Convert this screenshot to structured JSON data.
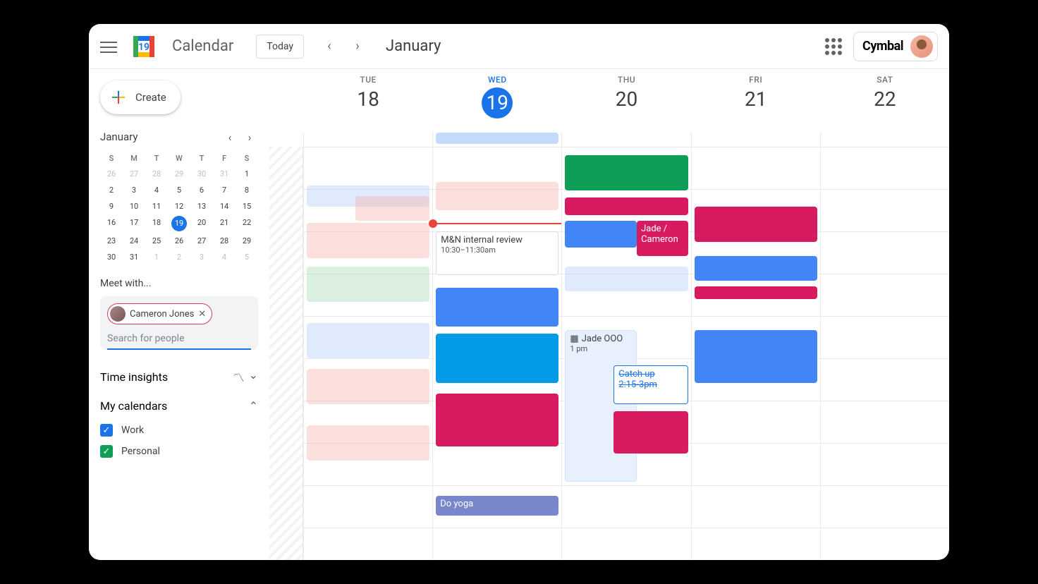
{
  "header": {
    "app_title": "Calendar",
    "today_label": "Today",
    "month_title": "January",
    "org_name": "Cymbal"
  },
  "sidebar": {
    "create_label": "Create",
    "mini_month": "January",
    "dow": [
      "S",
      "M",
      "T",
      "W",
      "T",
      "F",
      "S"
    ],
    "weeks": [
      [
        "26",
        "27",
        "28",
        "29",
        "30",
        "31",
        "1"
      ],
      [
        "2",
        "3",
        "4",
        "5",
        "6",
        "7",
        "8"
      ],
      [
        "9",
        "10",
        "11",
        "12",
        "13",
        "14",
        "15"
      ],
      [
        "16",
        "17",
        "18",
        "19",
        "20",
        "21",
        "22"
      ],
      [
        "23",
        "24",
        "25",
        "26",
        "27",
        "28",
        "29"
      ],
      [
        "30",
        "31",
        "1",
        "2",
        "3",
        "4",
        "5"
      ]
    ],
    "meet_with_label": "Meet with...",
    "chip_name": "Cameron Jones",
    "search_placeholder": "Search for people",
    "time_insights_label": "Time insights",
    "my_calendars_label": "My calendars",
    "calendars": [
      {
        "name": "Work",
        "color": "blue"
      },
      {
        "name": "Personal",
        "color": "green"
      }
    ]
  },
  "days": [
    {
      "dow": "TUE",
      "num": "18"
    },
    {
      "dow": "WED",
      "num": "19",
      "today": true
    },
    {
      "dow": "THU",
      "num": "20"
    },
    {
      "dow": "FRI",
      "num": "21"
    },
    {
      "dow": "SAT",
      "num": "22"
    }
  ],
  "events": {
    "mn_review_title": "M&N internal review",
    "mn_review_time": "10:30–11:30am",
    "jade_cameron": "Jade / Cameron",
    "jade_ooo_title": "Jade OOO",
    "jade_ooo_time": "1 pm",
    "catchup_title": "Catch up",
    "catchup_time": "2:15-3pm",
    "do_yoga": "Do yoga"
  }
}
